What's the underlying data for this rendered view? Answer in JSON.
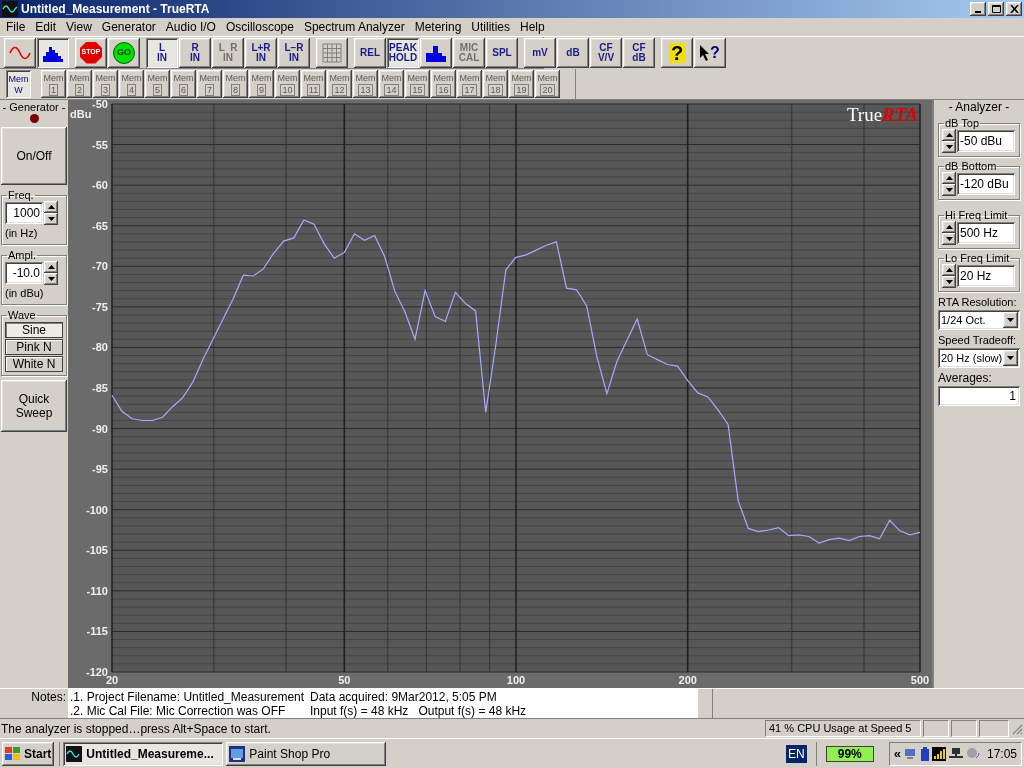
{
  "window": {
    "title": "Untitled_Measurement - TrueRTA"
  },
  "menu": [
    "File",
    "Edit",
    "View",
    "Generator",
    "Audio I/O",
    "Oscilloscope",
    "Spectrum Analyzer",
    "Metering",
    "Utilities",
    "Help"
  ],
  "toolbar": [
    [
      {
        "kind": "sine",
        "pressed": false,
        "disabled": false
      },
      {
        "kind": "spectrum",
        "pressed": true,
        "disabled": false
      }
    ],
    [
      {
        "kind": "stop",
        "lines": [
          "STOP"
        ],
        "pressed": false,
        "disabled": false
      },
      {
        "kind": "go",
        "lines": [
          "GO"
        ],
        "pressed": false,
        "disabled": false
      }
    ],
    [
      {
        "kind": "text",
        "lines": [
          "L",
          "IN"
        ],
        "pressed": true,
        "disabled": false
      },
      {
        "kind": "text",
        "lines": [
          "R",
          "IN"
        ],
        "pressed": false,
        "disabled": false
      },
      {
        "kind": "text",
        "lines": [
          "L  R",
          "IN"
        ],
        "pressed": false,
        "disabled": true
      },
      {
        "kind": "text",
        "lines": [
          "L+R",
          "IN"
        ],
        "pressed": false,
        "disabled": false
      },
      {
        "kind": "text",
        "lines": [
          "L−R",
          "IN"
        ],
        "pressed": false,
        "disabled": false
      }
    ],
    [
      {
        "kind": "grid",
        "pressed": false,
        "disabled": false
      }
    ],
    [
      {
        "kind": "text",
        "lines": [
          "REL"
        ],
        "pressed": false,
        "disabled": false
      },
      {
        "kind": "text",
        "lines": [
          "PEAK",
          "HOLD"
        ],
        "pressed": true,
        "disabled": false
      },
      {
        "kind": "bars",
        "pressed": false,
        "disabled": false
      },
      {
        "kind": "text",
        "lines": [
          "MIC",
          "CAL"
        ],
        "pressed": false,
        "disabled": true
      },
      {
        "kind": "text",
        "lines": [
          "SPL"
        ],
        "pressed": false,
        "disabled": false
      }
    ],
    [
      {
        "kind": "text",
        "lines": [
          "mV"
        ],
        "pressed": false,
        "disabled": false
      },
      {
        "kind": "text",
        "lines": [
          "dB"
        ],
        "pressed": false,
        "disabled": false
      },
      {
        "kind": "text",
        "lines": [
          "CF",
          "V/V"
        ],
        "pressed": false,
        "disabled": false
      },
      {
        "kind": "text",
        "lines": [
          "CF",
          "dB"
        ],
        "pressed": false,
        "disabled": false
      }
    ],
    [
      {
        "kind": "help",
        "lines": [
          "?"
        ],
        "pressed": false,
        "disabled": false
      },
      {
        "kind": "whatsthis",
        "lines": [
          "?"
        ],
        "pressed": false,
        "disabled": false
      }
    ]
  ],
  "memory_bar": [
    {
      "lines": [
        "Mem",
        "W"
      ],
      "pressed": true,
      "disabled": false
    },
    {
      "lines": [
        "Mem",
        "1"
      ],
      "pressed": false,
      "disabled": true
    },
    {
      "lines": [
        "Mem",
        "2"
      ],
      "pressed": false,
      "disabled": true
    },
    {
      "lines": [
        "Mem",
        "3"
      ],
      "pressed": false,
      "disabled": true
    },
    {
      "lines": [
        "Mem",
        "4"
      ],
      "pressed": false,
      "disabled": true
    },
    {
      "lines": [
        "Mem",
        "5"
      ],
      "pressed": false,
      "disabled": true
    },
    {
      "lines": [
        "Mem",
        "6"
      ],
      "pressed": false,
      "disabled": true
    },
    {
      "lines": [
        "Mem",
        "7"
      ],
      "pressed": false,
      "disabled": true
    },
    {
      "lines": [
        "Mem",
        "8"
      ],
      "pressed": false,
      "disabled": true
    },
    {
      "lines": [
        "Mem",
        "9"
      ],
      "pressed": false,
      "disabled": true
    },
    {
      "lines": [
        "Mem",
        "10"
      ],
      "pressed": false,
      "disabled": true
    },
    {
      "lines": [
        "Mem",
        "11"
      ],
      "pressed": false,
      "disabled": true
    },
    {
      "lines": [
        "Mem",
        "12"
      ],
      "pressed": false,
      "disabled": true
    },
    {
      "lines": [
        "Mem",
        "13"
      ],
      "pressed": false,
      "disabled": true
    },
    {
      "lines": [
        "Mem",
        "14"
      ],
      "pressed": false,
      "disabled": true
    },
    {
      "lines": [
        "Mem",
        "15"
      ],
      "pressed": false,
      "disabled": true
    },
    {
      "lines": [
        "Mem",
        "16"
      ],
      "pressed": false,
      "disabled": true
    },
    {
      "lines": [
        "Mem",
        "17"
      ],
      "pressed": false,
      "disabled": true
    },
    {
      "lines": [
        "Mem",
        "18"
      ],
      "pressed": false,
      "disabled": true
    },
    {
      "lines": [
        "Mem",
        "19"
      ],
      "pressed": false,
      "disabled": true
    },
    {
      "lines": [
        "Mem",
        "20"
      ],
      "pressed": false,
      "disabled": true
    }
  ],
  "generator": {
    "title": "- Generator -",
    "on": false,
    "power_button": "On/Off",
    "freq": {
      "label": "Freq.",
      "value": "1000",
      "unit": "(in Hz)"
    },
    "ampl": {
      "label": "Ampl.",
      "value": "-10.0",
      "unit": "(in dBu)"
    },
    "wave": {
      "label": "Wave",
      "options": [
        {
          "label": "Sine",
          "selected": true
        },
        {
          "label": "Pink N",
          "selected": false
        },
        {
          "label": "White N",
          "selected": false
        }
      ]
    },
    "sweep_button": "Quick Sweep"
  },
  "spectrum": {
    "y_unit": "dBu",
    "logo": {
      "plain": "True",
      "accent": "RTA"
    },
    "chart_data": {
      "type": "line",
      "categories": [
        "20",
        null,
        null,
        null,
        null,
        null,
        null,
        null,
        null,
        null,
        null,
        null,
        null,
        null,
        null,
        null,
        null,
        null,
        null,
        null,
        null,
        null,
        null,
        "50",
        null,
        null,
        null,
        null,
        null,
        null,
        null,
        null,
        null,
        null,
        null,
        null,
        null,
        null,
        null,
        null,
        "100",
        null,
        null,
        null,
        null,
        null,
        null,
        null,
        null,
        null,
        null,
        null,
        null,
        null,
        null,
        null,
        null,
        "200",
        null,
        null,
        null,
        null,
        null,
        null,
        null,
        null,
        null,
        null,
        null,
        null,
        null,
        null,
        null,
        null,
        null,
        null,
        null,
        null,
        null,
        null,
        "500"
      ],
      "series": [
        {
          "color": "#a8a8ff",
          "values": [
            -85.9,
            -87.9,
            -88.8,
            -89.0,
            -89.0,
            -88.6,
            -87.3,
            -86.2,
            -84.3,
            -81.5,
            -79.0,
            -76.5,
            -74.0,
            -71.1,
            -71.2,
            -70.3,
            -68.4,
            -66.9,
            -66.5,
            -64.3,
            -64.8,
            -67.2,
            -69.0,
            -68.3,
            -66.0,
            -66.8,
            -66.2,
            -68.8,
            -73.1,
            -75.6,
            -79.0,
            -73.0,
            -76.2,
            -76.8,
            -73.2,
            -74.6,
            -75.5,
            -88.0,
            -79.7,
            -70.4,
            -68.9,
            -68.6,
            -68.0,
            -67.4,
            -67.0,
            -72.7,
            -72.9,
            -74.9,
            -81.1,
            -85.7,
            -81.7,
            -79.1,
            -76.5,
            -80.9,
            -81.5,
            -82.1,
            -82.3,
            -84.1,
            -85.6,
            -86.1,
            -87.7,
            -89.5,
            -98.9,
            -102.3,
            -102.7,
            -102.5,
            -102.2,
            -103.2,
            -103.1,
            -103.3,
            -104.1,
            -103.7,
            -103.5,
            -103.8,
            -103.3,
            -103.2,
            -103.6,
            -101.3,
            -102.6,
            -103.1,
            -102.8
          ]
        }
      ],
      "ylim": [
        -120,
        -50
      ],
      "grid": true,
      "yticks": [
        -50,
        -55,
        -60,
        -65,
        -70,
        -75,
        -80,
        -85,
        -90,
        -95,
        -100,
        -105,
        -110,
        -115,
        -120
      ]
    }
  },
  "analyzer": {
    "title": "- Analyzer -",
    "spinners": [
      {
        "label": "dB Top",
        "value": "-50 dBu"
      },
      {
        "label": "dB Bottom",
        "value": "-120 dBu"
      },
      {
        "label": "Hi Freq Limit",
        "value": "500 Hz"
      },
      {
        "label": "Lo Freq Limit",
        "value": "20 Hz"
      }
    ],
    "dropdowns": [
      {
        "label": "RTA Resolution:",
        "value": "1/24 Oct."
      },
      {
        "label": "Speed Tradeoff:",
        "value": "20 Hz (slow)"
      }
    ],
    "averages": {
      "label": "Averages:",
      "value": "1"
    }
  },
  "notes": {
    "label": "Notes:",
    "rows": [
      [
        ".1. Project Filename: Untitled_Measurement",
        "Data acquired: 9Mar2012, 5:05 PM"
      ],
      [
        ".2. Mic Cal File: Mic Correction was OFF",
        "Input f(s) = 48 kHz   Output f(s) = 48 kHz"
      ]
    ]
  },
  "status_bar": {
    "message": "The analyzer is stopped…press Alt+Space to start.",
    "cpu": "41 % CPU Usage at Speed 5"
  },
  "taskbar": {
    "start": "Start",
    "tasks": [
      {
        "label": "Untitled_Measureme...",
        "selected": true
      },
      {
        "label": "Paint Shop Pro",
        "selected": false
      }
    ],
    "language": "EN",
    "battery": "99%",
    "tray_expand": "«",
    "clock": "17:05"
  }
}
